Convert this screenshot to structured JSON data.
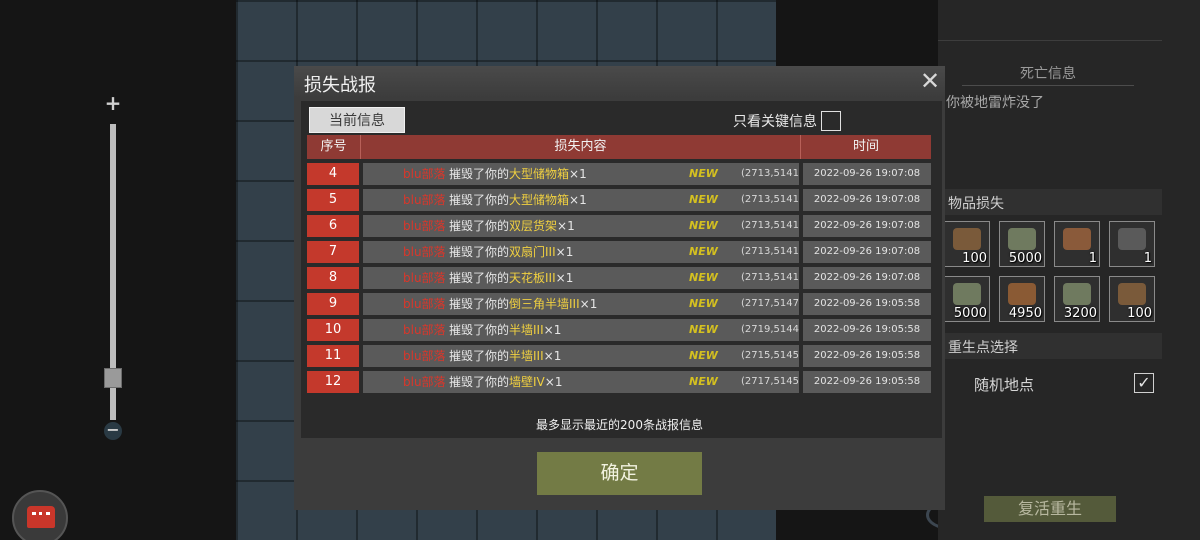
{
  "dialog": {
    "title": "损失战报",
    "close_icon": "close-icon",
    "tab_current": "当前信息",
    "key_only_label": "只看关键信息",
    "key_only_checked": false,
    "columns": {
      "index": "序号",
      "content": "损失内容",
      "time": "时间"
    },
    "rows": [
      {
        "index": "4",
        "player": "blu部落",
        "action_pre": "摧毁了你的",
        "item": "大型储物箱",
        "qty": "×1",
        "new_tag": "NEW",
        "coord": "(2713,5141)",
        "time": "2022-09-26 19:07:08"
      },
      {
        "index": "5",
        "player": "blu部落",
        "action_pre": "摧毁了你的",
        "item": "大型储物箱",
        "qty": "×1",
        "new_tag": "NEW",
        "coord": "(2713,5141)",
        "time": "2022-09-26 19:07:08"
      },
      {
        "index": "6",
        "player": "blu部落",
        "action_pre": "摧毁了你的",
        "item": "双层货架",
        "qty": "×1",
        "new_tag": "NEW",
        "coord": "(2713,5141)",
        "time": "2022-09-26 19:07:08"
      },
      {
        "index": "7",
        "player": "blu部落",
        "action_pre": "摧毁了你的",
        "item": "双扇门III",
        "qty": "×1",
        "new_tag": "NEW",
        "coord": "(2713,5141)",
        "time": "2022-09-26 19:07:08"
      },
      {
        "index": "8",
        "player": "blu部落",
        "action_pre": "摧毁了你的",
        "item": "天花板III",
        "qty": "×1",
        "new_tag": "NEW",
        "coord": "(2713,5141)",
        "time": "2022-09-26 19:07:08"
      },
      {
        "index": "9",
        "player": "blu部落",
        "action_pre": "摧毁了你的",
        "item": "倒三角半墙III",
        "qty": "×1",
        "new_tag": "NEW",
        "coord": "(2717,5147)",
        "time": "2022-09-26 19:05:58"
      },
      {
        "index": "10",
        "player": "blu部落",
        "action_pre": "摧毁了你的",
        "item": "半墙III",
        "qty": "×1",
        "new_tag": "NEW",
        "coord": "(2719,5144)",
        "time": "2022-09-26 19:05:58"
      },
      {
        "index": "11",
        "player": "blu部落",
        "action_pre": "摧毁了你的",
        "item": "半墙III",
        "qty": "×1",
        "new_tag": "NEW",
        "coord": "(2715,5145)",
        "time": "2022-09-26 19:05:58"
      },
      {
        "index": "12",
        "player": "blu部落",
        "action_pre": "摧毁了你的",
        "item": "墙壁IV",
        "qty": "×1",
        "new_tag": "NEW",
        "coord": "(2717,5145)",
        "time": "2022-09-26 19:05:58"
      }
    ],
    "note": "最多显示最近的200条战报信息",
    "confirm_label": "确定"
  },
  "map": {
    "zoom_in_icon": "plus-icon",
    "zoom_out_icon": "minus-icon",
    "zoom_level": 0.1,
    "gift_icon": "gift-icon"
  },
  "right_panel": {
    "death_title": "死亡信息",
    "death_text": "你被地雷炸没了",
    "items_title": "物品损失",
    "items": [
      {
        "icon": "ammo-box-icon",
        "count": "100",
        "color": "#7a5a3a"
      },
      {
        "icon": "stone-pile-icon",
        "count": "5000",
        "color": "#6f7a5f"
      },
      {
        "icon": "wrench-icon",
        "count": "1",
        "color": "#8a5a3a"
      },
      {
        "icon": "pistol-icon",
        "count": "1",
        "color": "#5a5a5a"
      },
      {
        "icon": "stone-pile-icon",
        "count": "5000",
        "color": "#6f7a5f"
      },
      {
        "icon": "wood-logs-icon",
        "count": "4950",
        "color": "#8a5a34"
      },
      {
        "icon": "stone-pile-icon",
        "count": "3200",
        "color": "#6f7a5f"
      },
      {
        "icon": "ammo-box-icon",
        "count": "100",
        "color": "#7a5a3a"
      }
    ],
    "respawn_title": "重生点选择",
    "random_location_label": "随机地点",
    "random_location_checked": true,
    "revive_label": "复活重生"
  }
}
